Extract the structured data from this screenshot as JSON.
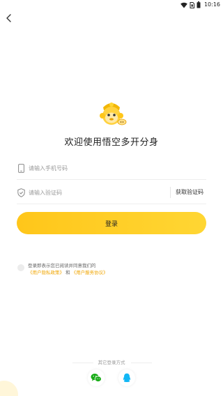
{
  "status_bar": {
    "time": "10:16"
  },
  "header": {
    "back_icon": "chevron-left-icon"
  },
  "logo": {
    "icon": "monkey-king-logo"
  },
  "title": "欢迎使用悟空多开分身",
  "phone_field": {
    "placeholder": "请输入手机号码",
    "icon": "phone-icon"
  },
  "code_field": {
    "placeholder": "请输入验证码",
    "icon": "shield-icon",
    "get_code_label": "获取验证码"
  },
  "login_button": {
    "label": "登录"
  },
  "agreement": {
    "text": "登录即表示您已阅读并同意我们的",
    "privacy_link": "《用户隐私政策》",
    "and": "和",
    "terms_link": "《用户服务协议》"
  },
  "other_login": {
    "label": "其它登录方式"
  },
  "social": {
    "wechat_icon": "wechat-icon",
    "qq_icon": "qq-icon"
  },
  "colors": {
    "accent": "#FFC61A",
    "link": "#F0A500",
    "wechat": "#1AAD19",
    "qq": "#12B7F5"
  }
}
